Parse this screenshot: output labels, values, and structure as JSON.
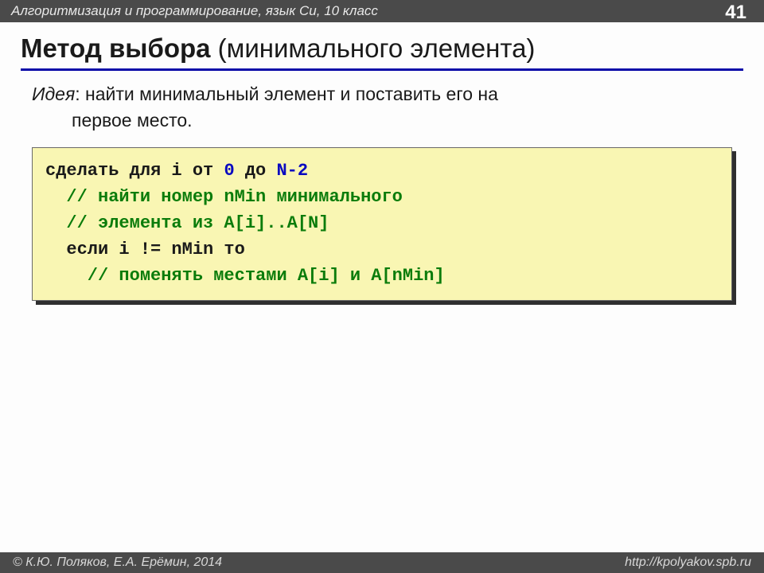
{
  "header": {
    "course": "Алгоритмизация и программирование, язык Си, 10 класс",
    "page": "41"
  },
  "title": {
    "bold": "Метод выбора",
    "paren": " (минимального элемента)"
  },
  "idea": {
    "lead": "Идея",
    "rest": ": найти минимальный элемент и поставить его на",
    "cont": "первое место."
  },
  "code": {
    "l1a": "сделать для i от ",
    "l1b": "0",
    "l1c": " до ",
    "l1d": "N-2",
    "l2": "  // найти номер nMin минимального",
    "l3": "  // элемента из A[i]..A[N]",
    "l4": "  если i != nMin то",
    "l5": "    // поменять местами A[i] и A[nMin]"
  },
  "footer": {
    "left": "© К.Ю. Поляков, Е.А. Ерёмин, 2014",
    "right": "http://kpolyakov.spb.ru"
  }
}
